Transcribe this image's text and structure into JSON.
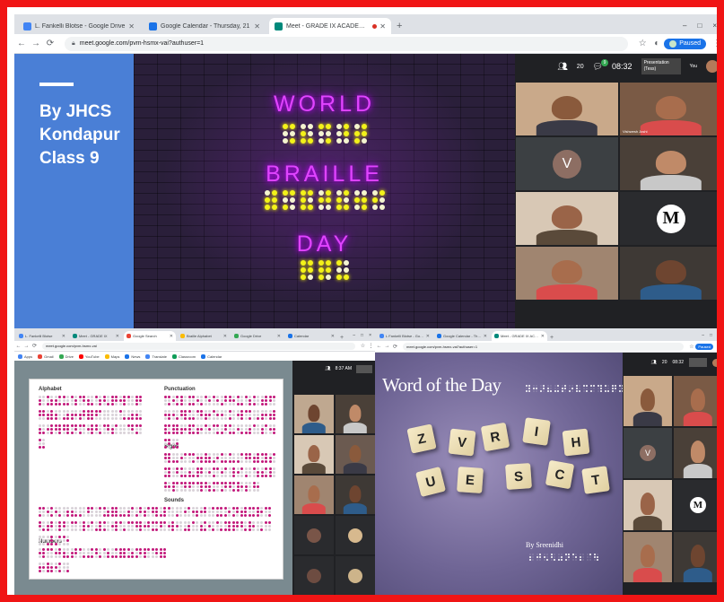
{
  "top_window": {
    "tabs": [
      {
        "label": "L. Fankelli Blotse - Google Drive",
        "color": "#4285f4",
        "active": false
      },
      {
        "label": "Google Calendar - Thursday, 21",
        "color": "#1a73e8",
        "active": false
      },
      {
        "label": "Meet - GRADE IX ACADEMIC",
        "color": "#00897b",
        "active": true
      }
    ],
    "new_tab": "+",
    "window_controls": [
      "–",
      "□",
      "×"
    ],
    "url": "meet.google.com/pvm-hsmx-vai?authuser=1",
    "paused_label": "Paused",
    "slide": {
      "left_text_lines": [
        "By JHCS",
        "Kondapur",
        "Class 9"
      ],
      "word1": "WORLD",
      "word2": "BRAILLE",
      "word3": "DAY"
    },
    "meet": {
      "count": "20",
      "chat_badge": "9",
      "time": "08:32",
      "presenting_label": "Presentation (Tess)",
      "you_label": "You",
      "tiles": [
        {
          "type": "video",
          "name": ""
        },
        {
          "type": "video",
          "name": "Vishwesh Joshi"
        },
        {
          "type": "letter",
          "letter": "V",
          "color": "#8d6e63"
        },
        {
          "type": "video",
          "name": ""
        },
        {
          "type": "video",
          "name": ""
        },
        {
          "type": "logo",
          "letter": "M"
        },
        {
          "type": "video",
          "name": ""
        },
        {
          "type": "video",
          "name": ""
        }
      ]
    }
  },
  "left_window": {
    "tabs": [
      {
        "label": "L. Fankelli Blotse",
        "color": "#4285f4"
      },
      {
        "label": "Meet - GRADE IX",
        "color": "#00897b"
      },
      {
        "label": "Google Search",
        "color": "#ea4335"
      },
      {
        "label": "Braille Alphabet",
        "color": "#fbbc04"
      },
      {
        "label": "Google Drive",
        "color": "#34a853"
      },
      {
        "label": "Calendar",
        "color": "#1a73e8"
      }
    ],
    "url": "meet.google.com/pvm-hsmx-vai",
    "bookmarks": [
      "Apps",
      "Gmail",
      "Drive",
      "YouTube",
      "Maps",
      "News",
      "Translate",
      "Classroom",
      "Calendar"
    ],
    "chart_labels": {
      "alphabet": "Alphabet",
      "punctuation": "Punctuation",
      "signs": "Signs",
      "sounds": "Sounds",
      "numbers": "Numbers"
    },
    "meet": {
      "time": "8:37 AM"
    }
  },
  "right_window": {
    "tabs": [
      {
        "label": "L Fankelli Blotse - Google Drive",
        "color": "#4285f4"
      },
      {
        "label": "Google Calendar - Thursday, 21",
        "color": "#1a73e8"
      },
      {
        "label": "Meet - GRADE IX ACADEMIC",
        "color": "#00897b"
      }
    ],
    "url": "meet.google.com/pvm-hsmx-vai?authuser=1",
    "paused_label": "Paused",
    "slide": {
      "title": "Word of the Day",
      "letters": [
        "Z",
        "V",
        "R",
        "I",
        "H",
        "U",
        "E",
        "S",
        "C",
        "T"
      ],
      "byline": "By Sreenidhi"
    },
    "meet": {
      "count": "20",
      "time": "08:32"
    }
  }
}
